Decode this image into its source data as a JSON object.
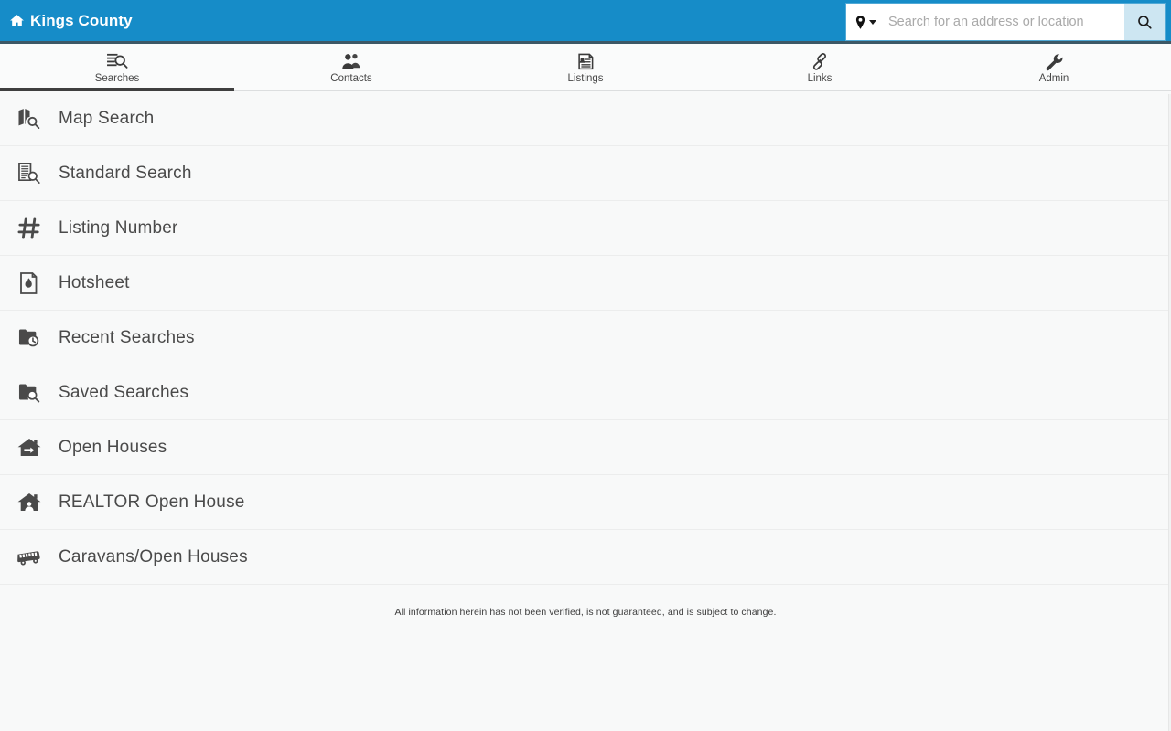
{
  "header": {
    "brand_title": "Kings County",
    "brand_icon": "home-icon",
    "search": {
      "pin_icon": "map-pin-icon",
      "caret_icon": "chevron-down-icon",
      "placeholder": "Search for an address or location",
      "value": "",
      "button_icon": "search-icon"
    },
    "colors": {
      "header_blue": "#168CC8",
      "header_border": "#3C5866",
      "search_button_bg": "#CDE6F2"
    }
  },
  "tabs": [
    {
      "label": "Searches",
      "icon": "list-search-icon",
      "active": true
    },
    {
      "label": "Contacts",
      "icon": "people-icon",
      "active": false
    },
    {
      "label": "Listings",
      "icon": "listing-document-icon",
      "active": false
    },
    {
      "label": "Links",
      "icon": "chain-link-icon",
      "active": false
    },
    {
      "label": "Admin",
      "icon": "wrench-icon",
      "active": false
    }
  ],
  "tab_indicator_color": "#3F3F3F",
  "menu": {
    "items": [
      {
        "label": "Map Search",
        "icon": "map-search-icon"
      },
      {
        "label": "Standard Search",
        "icon": "document-search-icon"
      },
      {
        "label": "Listing Number",
        "icon": "hash-icon"
      },
      {
        "label": "Hotsheet",
        "icon": "flame-document-icon"
      },
      {
        "label": "Recent Searches",
        "icon": "folder-clock-icon"
      },
      {
        "label": "Saved Searches",
        "icon": "folder-search-icon"
      },
      {
        "label": "Open Houses",
        "icon": "house-arrow-icon"
      },
      {
        "label": "REALTOR Open House",
        "icon": "house-person-icon"
      },
      {
        "label": "Caravans/Open Houses",
        "icon": "bus-icon"
      }
    ]
  },
  "footer": {
    "disclaimer": "All information herein has not been verified, is not guaranteed, and is subject to change."
  }
}
